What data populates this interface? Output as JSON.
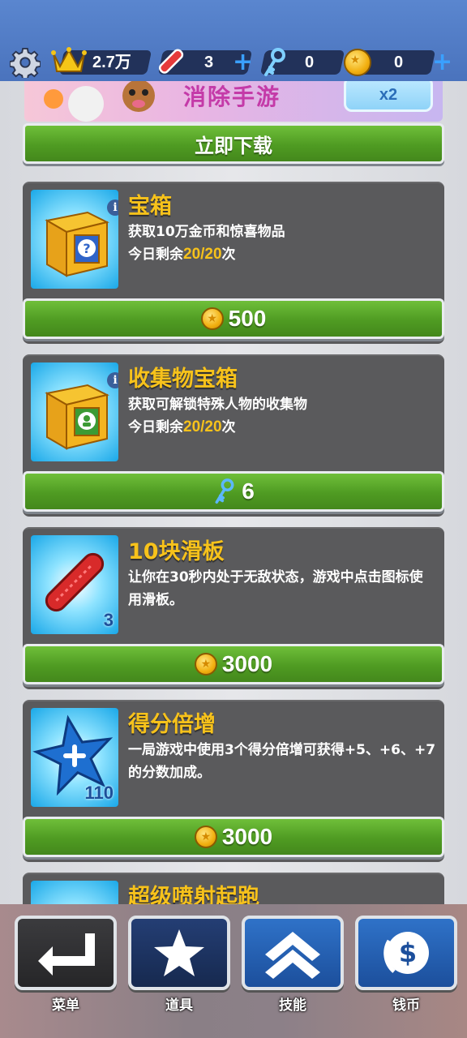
{
  "topbar": {
    "score": "2.7万",
    "hoverboards": "3",
    "keys": "0",
    "coins": "0",
    "plus": "+"
  },
  "ad": {
    "title": "消除手游",
    "badge": "x2",
    "download_label": "立即下载"
  },
  "items": [
    {
      "title": "宝箱",
      "desc": "获取10万金币和惊喜物品",
      "remaining_prefix": "今日剩余",
      "remaining": "20/20",
      "remaining_suffix": "次",
      "price": "500",
      "currency": "coin-icon",
      "info": "i"
    },
    {
      "title": "收集物宝箱",
      "desc": "获取可解锁特殊人物的收集物",
      "remaining_prefix": "今日剩余",
      "remaining": "20/20",
      "remaining_suffix": "次",
      "price": "6",
      "currency": "key-icon",
      "info": "i"
    },
    {
      "title": "10块滑板",
      "desc": "让你在30秒内处于无敌状态，游戏中点击图标使用滑板。",
      "qty": "3",
      "price": "3000",
      "currency": "coin-icon"
    },
    {
      "title": "得分倍增",
      "desc": "一局游戏中使用3个得分倍增可获得+5、+6、+7的分数加成。",
      "qty": "110",
      "price": "3000",
      "currency": "coin-icon"
    },
    {
      "title": "超级喷射起跑"
    }
  ],
  "nav": {
    "menu": "菜单",
    "items": "道具",
    "skills": "技能",
    "coins": "钱币"
  },
  "colors": {
    "accent_gold": "#f7c21b",
    "button_green": "#4f9b22",
    "card_bg": "#5a5a5c",
    "topbar_blue": "#4a73bd"
  }
}
